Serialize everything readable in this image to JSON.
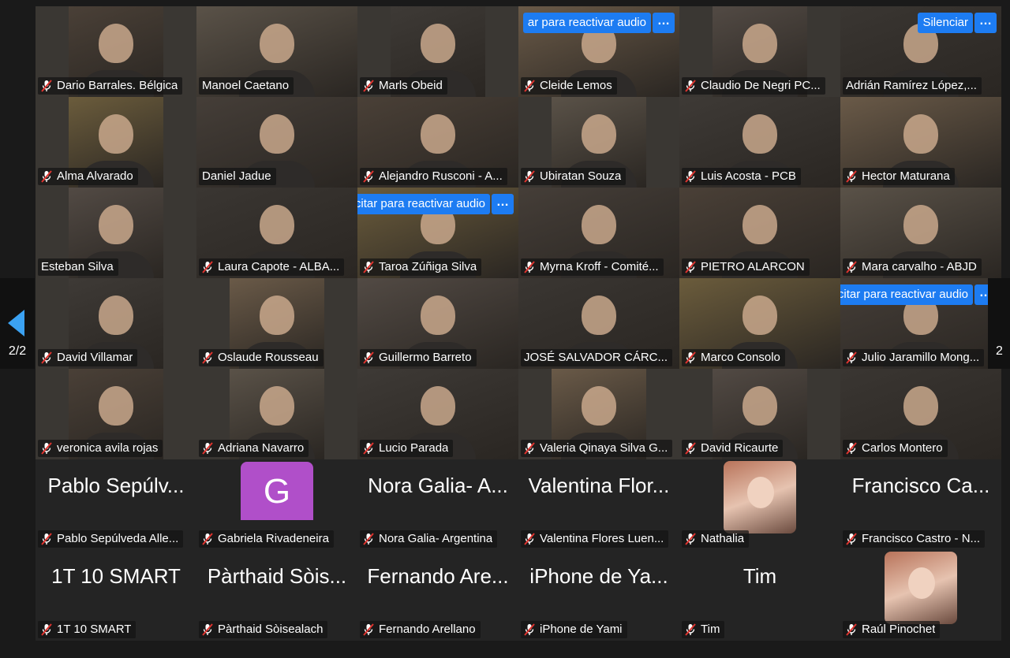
{
  "pagination": {
    "label": "2/2",
    "next_label": "2"
  },
  "colors": {
    "active_border": "#3bd14b",
    "accent_blue": "#1d7cf2",
    "arrow_blue": "#3ba2f2",
    "avatar_purple": "#b04fc9"
  },
  "icons": {
    "mic": "muted-mic-icon",
    "prev": "prev-page-arrow-icon",
    "more": "more-options-icon"
  },
  "participants": [
    {
      "name": "Dario Barrales. Bélgica",
      "muted": true,
      "type": "video"
    },
    {
      "name": "Manoel Caetano",
      "muted": false,
      "type": "video"
    },
    {
      "name": "Marls Obeid",
      "muted": true,
      "type": "video"
    },
    {
      "name": "Cleide Lemos",
      "muted": true,
      "type": "video",
      "pill": "ar para reactivar audio"
    },
    {
      "name": "Claudio De Negri PC...",
      "muted": true,
      "type": "video"
    },
    {
      "name": "Adrián Ramírez López,...",
      "muted": false,
      "type": "video",
      "pill": "Silenciar"
    },
    {
      "name": "Alma Alvarado",
      "muted": true,
      "type": "video"
    },
    {
      "name": "Daniel Jadue",
      "muted": false,
      "type": "video",
      "active": true
    },
    {
      "name": "Alejandro Rusconi - A...",
      "muted": true,
      "type": "video"
    },
    {
      "name": "Ubiratan Souza",
      "muted": true,
      "type": "video"
    },
    {
      "name": "Luis Acosta - PCB",
      "muted": true,
      "type": "video"
    },
    {
      "name": "Hector Maturana",
      "muted": true,
      "type": "video"
    },
    {
      "name": "Esteban Silva",
      "muted": false,
      "type": "video"
    },
    {
      "name": "Laura Capote - ALBA...",
      "muted": true,
      "type": "video"
    },
    {
      "name": "Taroa Zúñiga Silva",
      "muted": true,
      "type": "video",
      "pill": "Solicitar para reactivar audio"
    },
    {
      "name": "Myrna Kroff - Comité...",
      "muted": true,
      "type": "video"
    },
    {
      "name": "PIETRO ALARCON",
      "muted": true,
      "type": "video"
    },
    {
      "name": "Mara carvalho - ABJD",
      "muted": true,
      "type": "video"
    },
    {
      "name": "David Villamar",
      "muted": true,
      "type": "video"
    },
    {
      "name": "Oslaude Rousseau",
      "muted": true,
      "type": "video"
    },
    {
      "name": "Guillermo Barreto",
      "muted": true,
      "type": "video"
    },
    {
      "name": "JOSÉ SALVADOR CÁRC...",
      "muted": false,
      "type": "video"
    },
    {
      "name": "Marco Consolo",
      "muted": true,
      "type": "video"
    },
    {
      "name": "Julio Jaramillo Mong...",
      "muted": true,
      "type": "video",
      "pill": "Solicitar para reactivar audio"
    },
    {
      "name": "veronica avila rojas",
      "muted": true,
      "type": "video"
    },
    {
      "name": "Adriana Navarro",
      "muted": true,
      "type": "video"
    },
    {
      "name": "Lucio Parada",
      "muted": true,
      "type": "video"
    },
    {
      "name": "Valeria Qinaya Silva G...",
      "muted": true,
      "type": "video"
    },
    {
      "name": "David Ricaurte",
      "muted": true,
      "type": "video"
    },
    {
      "name": "Carlos Montero",
      "muted": true,
      "type": "video"
    },
    {
      "name": "Pablo Sepúlveda Alle...",
      "muted": true,
      "type": "text",
      "big": "Pablo Sepúlv..."
    },
    {
      "name": "Gabriela Rivadeneira",
      "muted": true,
      "type": "avatar",
      "initial": "G"
    },
    {
      "name": "Nora Galia- Argentina",
      "muted": true,
      "type": "text",
      "big": "Nora Galia- A..."
    },
    {
      "name": "Valentina Flores Luen...",
      "muted": true,
      "type": "text",
      "big": "Valentina Flor..."
    },
    {
      "name": "Nathalia",
      "muted": true,
      "type": "photo"
    },
    {
      "name": "Francisco Castro - N...",
      "muted": true,
      "type": "text",
      "big": "Francisco Ca..."
    },
    {
      "name": "1T 10 SMART",
      "muted": true,
      "type": "text",
      "big": "1T 10 SMART"
    },
    {
      "name": "Pàrthaid Sòisealach",
      "muted": true,
      "type": "text",
      "big": "Pàrthaid Sòis..."
    },
    {
      "name": "Fernando Arellano",
      "muted": true,
      "type": "text",
      "big": "Fernando Are..."
    },
    {
      "name": "iPhone de Yami",
      "muted": true,
      "type": "text",
      "big": "iPhone de Ya..."
    },
    {
      "name": "Tim",
      "muted": true,
      "type": "text",
      "big": "Tim"
    },
    {
      "name": "Raúl Pinochet",
      "muted": true,
      "type": "photo"
    }
  ]
}
